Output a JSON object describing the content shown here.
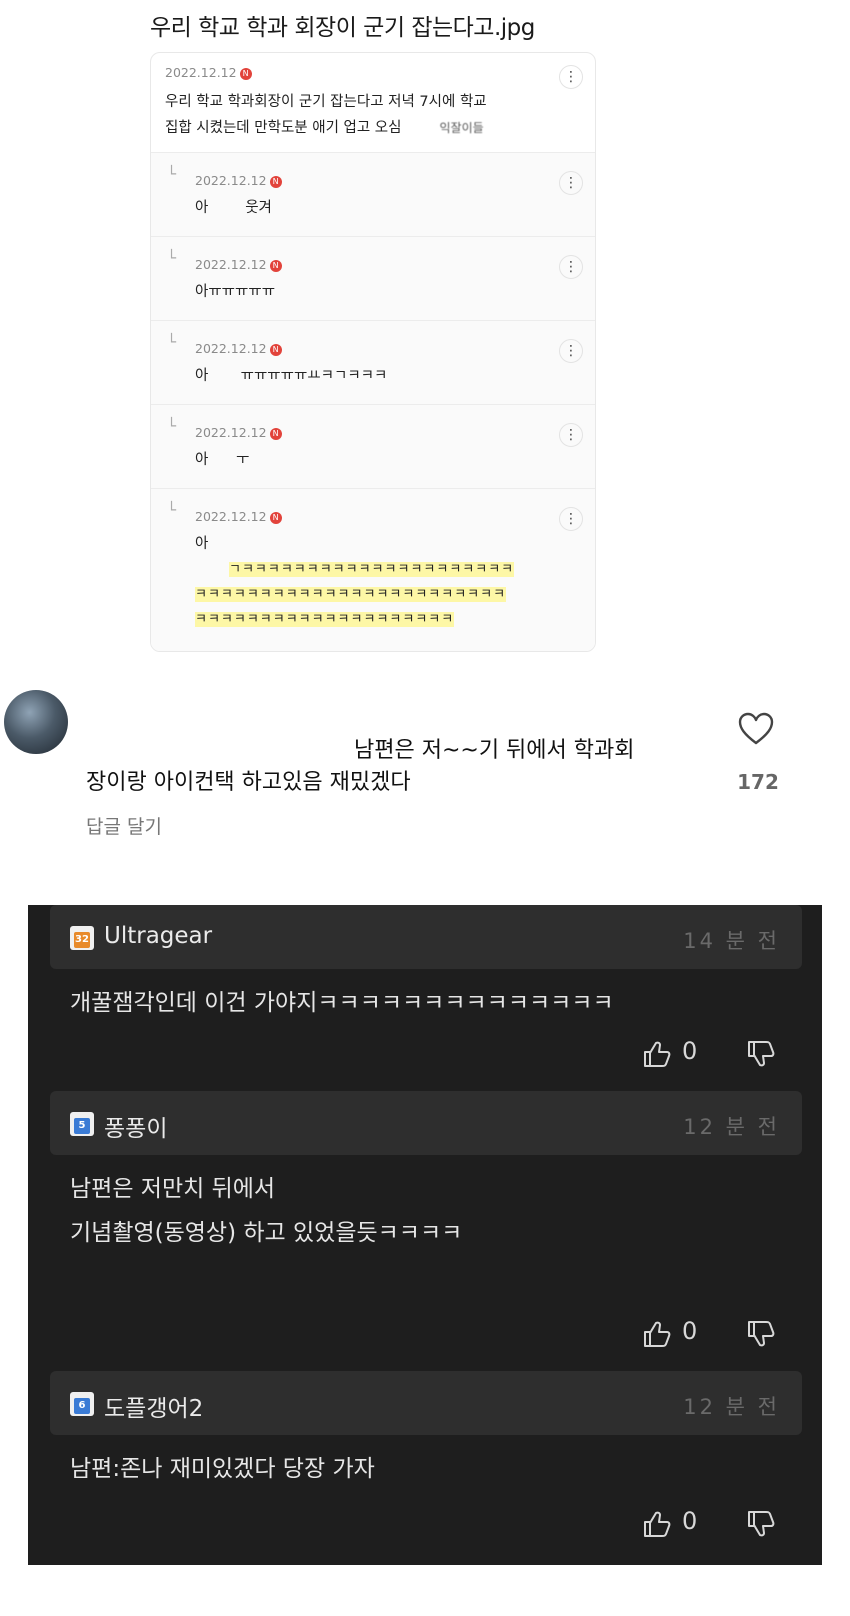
{
  "post": {
    "title": "우리 학교 학과 회장이 군기 잡는다고.jpg"
  },
  "screenshot": {
    "main": {
      "date": "2022.12.12",
      "badge": "N",
      "line1": "우리 학교 학과회장이 군기 잡는다고 저녁 7시에 학교",
      "line2": "집합 시켰는데 만학도분 애기 업고 오심",
      "line2_tail": "익잘이들"
    },
    "replies": [
      {
        "date": "2022.12.12",
        "badge": "N",
        "text": "아        웃겨"
      },
      {
        "date": "2022.12.12",
        "badge": "N",
        "text": "아ㅠㅠㅠㅠㅠ"
      },
      {
        "date": "2022.12.12",
        "badge": "N",
        "text": "아       ㅠㅠㅠㅠㅠㅛㅋㄱㅋㅋㅋ"
      },
      {
        "date": "2022.12.12",
        "badge": "N",
        "text": "아      ㅜ"
      },
      {
        "date": "2022.12.12",
        "badge": "N",
        "text": "아",
        "hl1": "ㄱㅋㅋㅋㅋㅋㅋㅋㅋㅋㅋㅋㅋㅋㅋㅋㅋㅋㅋㅋㅋㅋ",
        "hl2": "ㅋㅋㅋㅋㅋㅋㅋㅋㅋㅋㅋㅋㅋㅋㅋㅋㅋㅋㅋㅋㅋㅋㅋㅋ",
        "hl3": "ㅋㅋㅋㅋㅋㅋㅋㅋㅋㅋㅋㅋㅋㅋㅋㅋㅋㅋㅋㅋ"
      }
    ],
    "more_icon": "⋮"
  },
  "comment": {
    "line1": "남편은 저~~기 뒤에서 학과회",
    "line2": "장이랑 아이컨택 하고있음 재밌겠다",
    "reply_label": "답글 달기",
    "likes": "172"
  },
  "dark_comments": [
    {
      "level": "32",
      "level_color": "#e88a2a",
      "user": "Ultragear",
      "time": "14 분 전",
      "lines": [
        "개꿀잼각인데 이건 가야지ㅋㅋㅋㅋㅋㅋㅋㅋㅋㅋㅋㅋㅋㅋ"
      ],
      "likes": "0"
    },
    {
      "level": "5",
      "level_color": "#3a7bd5",
      "user": "퐁퐁이",
      "time": "12 분 전",
      "lines": [
        "남편은 저만치 뒤에서",
        "기념촬영(동영상) 하고 있었을듯ㅋㅋㅋㅋ"
      ],
      "likes": "0"
    },
    {
      "level": "6",
      "level_color": "#3a7bd5",
      "user": "도플갱어2",
      "time": "12 분 전",
      "lines": [
        "남편:존나 재미있겠다 당장 가자"
      ],
      "likes": "0"
    }
  ]
}
